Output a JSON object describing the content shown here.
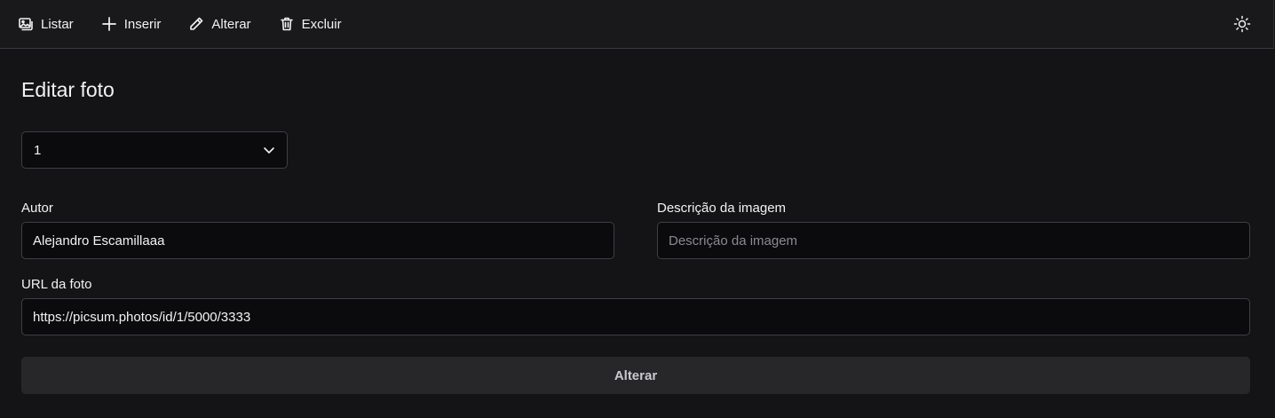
{
  "nav": {
    "items": [
      {
        "label": "Listar",
        "icon": "image-icon"
      },
      {
        "label": "Inserir",
        "icon": "plus-icon"
      },
      {
        "label": "Alterar",
        "icon": "pencil-icon"
      },
      {
        "label": "Excluir",
        "icon": "trash-icon"
      }
    ],
    "theme_icon": "sun-icon"
  },
  "page": {
    "title": "Editar foto"
  },
  "form": {
    "photo_select": {
      "value": "1"
    },
    "author": {
      "label": "Autor",
      "value": "Alejandro Escamillaaa"
    },
    "description": {
      "label": "Descrição da imagem",
      "value": "",
      "placeholder": "Descrição da imagem"
    },
    "url": {
      "label": "URL da foto",
      "value": "https://picsum.photos/id/1/5000/3333"
    },
    "submit_label": "Alterar"
  },
  "colors": {
    "background": "#141416",
    "navbar": "#19191b",
    "input_bg": "#0b0b0d",
    "button_bg": "#27272a"
  }
}
